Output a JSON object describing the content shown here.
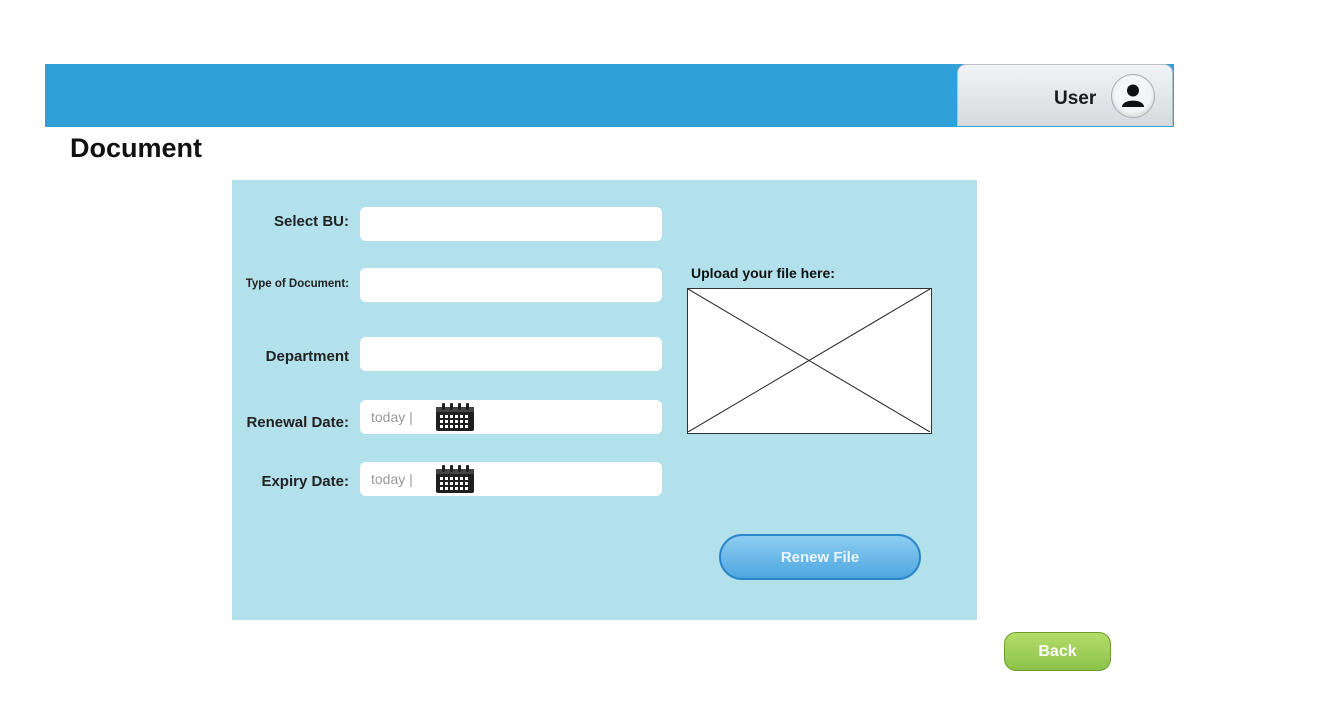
{
  "header": {
    "user_label": "User",
    "accent_color": "#2fa0d8",
    "avatar_icon": "user-icon"
  },
  "page": {
    "title": "Document"
  },
  "form": {
    "select_bu_label": "Select BU:",
    "type_of_document_label": "Type of Document:",
    "department_label": "Department",
    "renewal_date_label": "Renewal Date:",
    "renewal_date_placeholder": "today |",
    "expiry_date_label": "Expiry Date:",
    "expiry_date_placeholder": "today |",
    "calendar_icon": "calendar-icon",
    "panel_color": "#b2e0eb"
  },
  "upload": {
    "label": "Upload your file here:",
    "placeholder_icon": "image-placeholder-icon"
  },
  "actions": {
    "renew_label": "Renew File",
    "back_label": "Back",
    "renew_color": "#4ca7e0",
    "back_color": "#8bc34a"
  }
}
